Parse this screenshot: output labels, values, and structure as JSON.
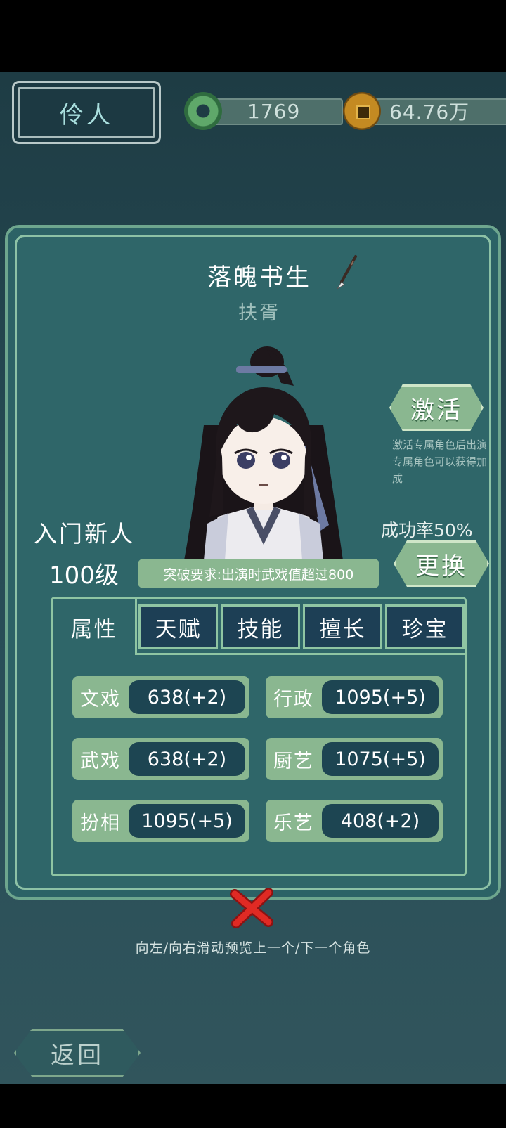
{
  "header": {
    "title": "伶人",
    "jade_amount": "1769",
    "coin_amount": "64.76万"
  },
  "character": {
    "name": "落魄书生",
    "subtitle": "扶胥",
    "rank": "入门新人",
    "level": "100级",
    "breakthrough": "突破要求:出演时武戏值超过800"
  },
  "actions": {
    "activate_label": "激活",
    "activate_note": "激活专属角色后出演专属角色可以获得加成",
    "success_rate": "成功率50%",
    "change_label": "更换"
  },
  "tabs": [
    "属性",
    "天赋",
    "技能",
    "擅长",
    "珍宝"
  ],
  "stats": [
    {
      "label": "文戏",
      "value": "638(+2)"
    },
    {
      "label": "行政",
      "value": "1095(+5)"
    },
    {
      "label": "武戏",
      "value": "638(+2)"
    },
    {
      "label": "厨艺",
      "value": "1075(+5)"
    },
    {
      "label": "扮相",
      "value": "1095(+5)"
    },
    {
      "label": "乐艺",
      "value": "408(+2)"
    }
  ],
  "footer": {
    "hint": "向左/向右滑动预览上一个/下一个角色",
    "back_label": "返回"
  },
  "colors": {
    "panel": "#2f6669",
    "button_green": "#8ab790",
    "value_dark": "#1d4552",
    "close_red": "#d8201f"
  }
}
